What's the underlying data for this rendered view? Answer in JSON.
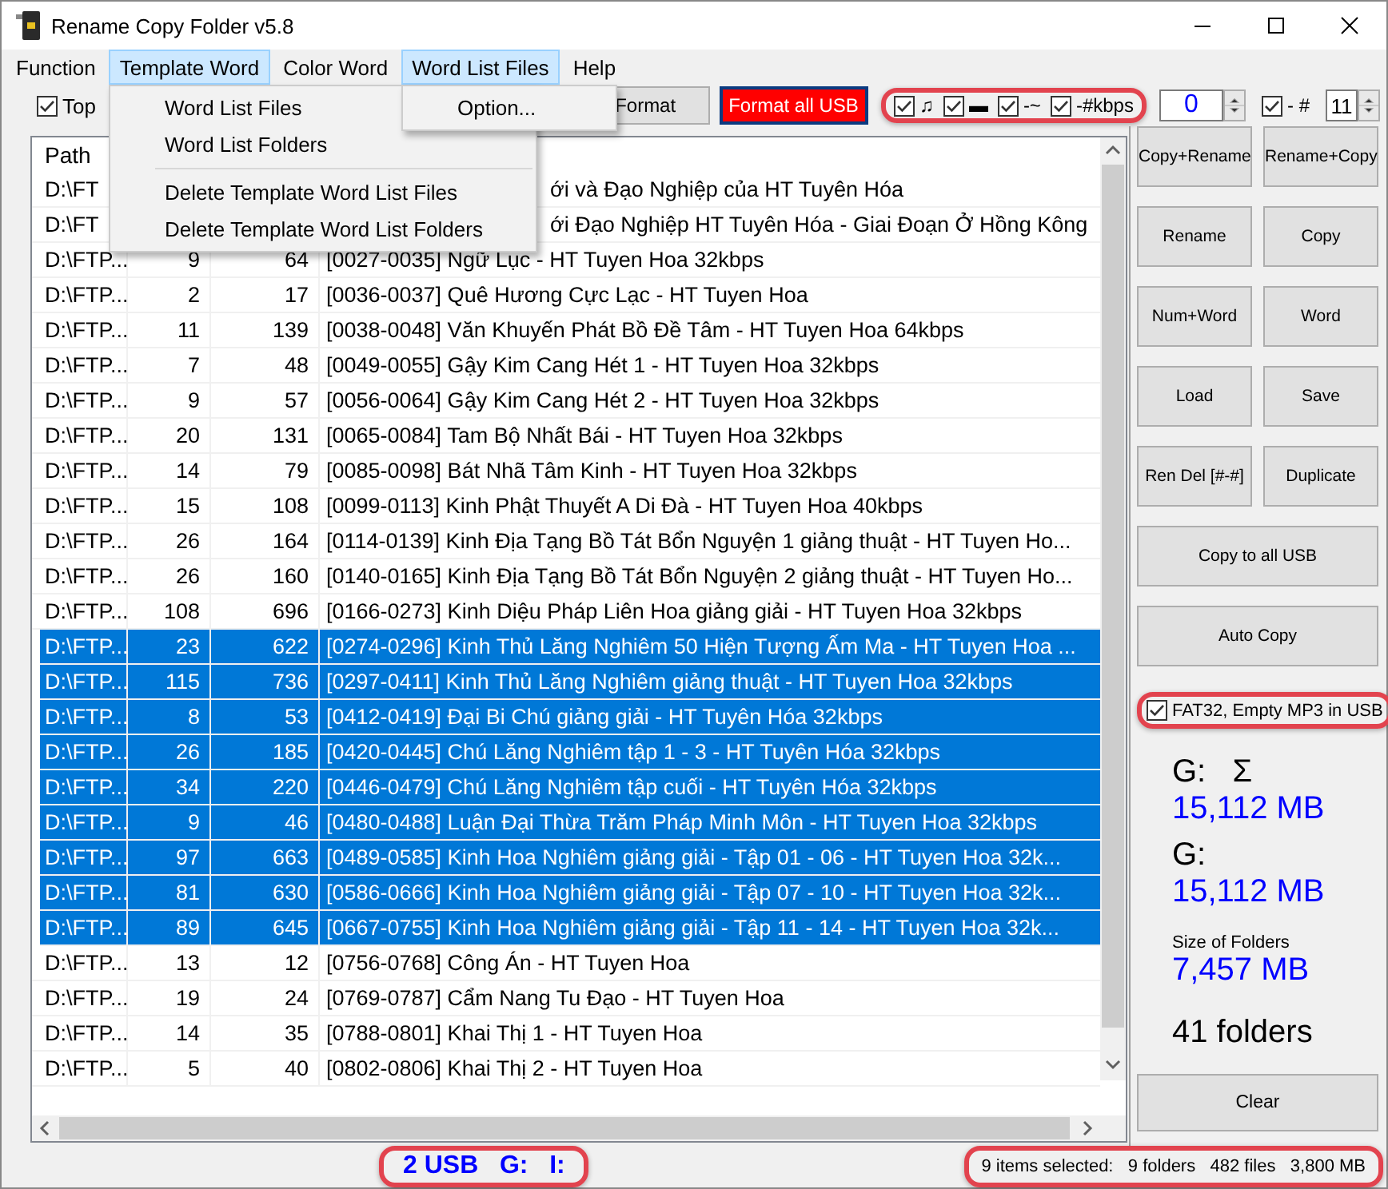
{
  "window": {
    "title": "Rename Copy Folder v5.8"
  },
  "menu_bar": [
    {
      "label": "Function",
      "open": false
    },
    {
      "label": "Template Word",
      "open": true,
      "items": [
        {
          "kind": "item",
          "label": "Word List Files"
        },
        {
          "kind": "item",
          "label": "Word List Folders"
        },
        {
          "kind": "separator"
        },
        {
          "kind": "item",
          "label": "Delete Template Word List Files"
        },
        {
          "kind": "item",
          "label": "Delete Template Word List Folders"
        }
      ]
    },
    {
      "label": "Color Word",
      "open": false
    },
    {
      "label": "Word List Files",
      "open": true,
      "items": [
        {
          "kind": "item",
          "label": "Option..."
        }
      ]
    },
    {
      "label": "Help",
      "open": false
    }
  ],
  "toolbar": {
    "top_checkbox": {
      "label": "Top",
      "checked": true
    },
    "buttons": [
      {
        "label": "Format",
        "kind": "normal"
      },
      {
        "label": "Format all USB",
        "kind": "danger"
      }
    ],
    "option_checks": {
      "highlighted": true,
      "items": [
        {
          "label": "♫",
          "checked": true
        },
        {
          "label": "▬",
          "checked": true
        },
        {
          "label": "-~",
          "checked": true
        },
        {
          "label": "-#kbps",
          "checked": true
        }
      ]
    },
    "start_number": {
      "value": "0"
    },
    "number_check": {
      "label": "- #",
      "checked": true
    },
    "digits": {
      "value": "11"
    }
  },
  "table": {
    "columns": [
      {
        "label": "Path"
      }
    ],
    "rows": [
      {
        "path": "D:\\FT",
        "column_4": "ới và Đạo Nghiệp của HT Tuyên Hóa",
        "covered": true,
        "selected": false
      },
      {
        "path": "D:\\FT",
        "column_4": "ới Đạo Nghiệp HT Tuyên Hóa - Giai Đoạn Ở Hồng Kông",
        "covered": true,
        "selected": false
      },
      {
        "path": "D:\\FTP...",
        "column_2": "9",
        "column_3": "64",
        "column_4": "[0027-0035] Ngữ Lục - HT Tuyen Hoa 32kbps",
        "covered": false,
        "selected": false
      },
      {
        "path": "D:\\FTP...",
        "column_2": "2",
        "column_3": "17",
        "column_4": "[0036-0037] Quê Hương Cực Lạc - HT Tuyen Hoa",
        "covered": false,
        "selected": false
      },
      {
        "path": "D:\\FTP...",
        "column_2": "11",
        "column_3": "139",
        "column_4": "[0038-0048] Văn Khuyến Phát Bồ Đề Tâm - HT Tuyen Hoa 64kbps",
        "covered": false,
        "selected": false
      },
      {
        "path": "D:\\FTP...",
        "column_2": "7",
        "column_3": "48",
        "column_4": "[0049-0055] Gậy Kim Cang Hét 1 - HT Tuyen Hoa 32kbps",
        "covered": false,
        "selected": false
      },
      {
        "path": "D:\\FTP...",
        "column_2": "9",
        "column_3": "57",
        "column_4": "[0056-0064] Gậy Kim Cang Hét 2 - HT Tuyen Hoa 32kbps",
        "covered": false,
        "selected": false
      },
      {
        "path": "D:\\FTP...",
        "column_2": "20",
        "column_3": "131",
        "column_4": "[0065-0084] Tam Bộ Nhất Bái - HT Tuyen Hoa 32kbps",
        "covered": false,
        "selected": false
      },
      {
        "path": "D:\\FTP...",
        "column_2": "14",
        "column_3": "79",
        "column_4": "[0085-0098] Bát Nhã Tâm Kinh - HT Tuyen Hoa 32kbps",
        "covered": false,
        "selected": false
      },
      {
        "path": "D:\\FTP...",
        "column_2": "15",
        "column_3": "108",
        "column_4": "[0099-0113] Kinh Phật Thuyết A Di Đà - HT Tuyen Hoa 40kbps",
        "covered": false,
        "selected": false
      },
      {
        "path": "D:\\FTP...",
        "column_2": "26",
        "column_3": "164",
        "column_4": "[0114-0139] Kinh Địa Tạng Bồ Tát Bổn Nguyện 1 giảng thuật - HT Tuyen Ho...",
        "covered": false,
        "selected": false
      },
      {
        "path": "D:\\FTP...",
        "column_2": "26",
        "column_3": "160",
        "column_4": "[0140-0165] Kinh Địa Tạng Bồ Tát Bổn Nguyện 2 giảng thuật - HT Tuyen Ho...",
        "covered": false,
        "selected": false
      },
      {
        "path": "D:\\FTP...",
        "column_2": "108",
        "column_3": "696",
        "column_4": "[0166-0273] Kinh Diệu Pháp Liên Hoa giảng giải - HT Tuyen Hoa 32kbps",
        "covered": false,
        "selected": false
      },
      {
        "path": "D:\\FTP...",
        "column_2": "23",
        "column_3": "622",
        "column_4": "[0274-0296] Kinh Thủ Lăng Nghiêm 50 Hiện Tượng Ấm Ma - HT Tuyen Hoa ...",
        "covered": false,
        "selected": true
      },
      {
        "path": "D:\\FTP...",
        "column_2": "115",
        "column_3": "736",
        "column_4": "[0297-0411] Kinh Thủ Lăng Nghiêm giảng thuật - HT Tuyen Hoa 32kbps",
        "covered": false,
        "selected": true
      },
      {
        "path": "D:\\FTP...",
        "column_2": "8",
        "column_3": "53",
        "column_4": "[0412-0419] Đại Bi Chú giảng giải - HT Tuyên Hóa 32kbps",
        "covered": false,
        "selected": true
      },
      {
        "path": "D:\\FTP...",
        "column_2": "26",
        "column_3": "185",
        "column_4": "[0420-0445] Chú Lăng Nghiêm tập 1 - 3 - HT Tuyên Hóa 32kbps",
        "covered": false,
        "selected": true
      },
      {
        "path": "D:\\FTP...",
        "column_2": "34",
        "column_3": "220",
        "column_4": "[0446-0479] Chú Lăng Nghiêm tập cuối - HT Tuyên Hóa 32kbps",
        "covered": false,
        "selected": true
      },
      {
        "path": "D:\\FTP...",
        "column_2": "9",
        "column_3": "46",
        "column_4": "[0480-0488] Luận Đại Thừa Trăm Pháp Minh Môn - HT Tuyen Hoa 32kbps",
        "covered": false,
        "selected": true
      },
      {
        "path": "D:\\FTP...",
        "column_2": "97",
        "column_3": "663",
        "column_4": "[0489-0585] Kinh Hoa Nghiêm giảng giải - Tập 01 - 06 - HT Tuyen Hoa 32k...",
        "covered": false,
        "selected": true
      },
      {
        "path": "D:\\FTP...",
        "column_2": "81",
        "column_3": "630",
        "column_4": "[0586-0666] Kinh Hoa Nghiêm giảng giải - Tập 07 - 10 - HT Tuyen Hoa 32k...",
        "covered": false,
        "selected": true
      },
      {
        "path": "D:\\FTP...",
        "column_2": "89",
        "column_3": "645",
        "column_4": "[0667-0755] Kinh Hoa Nghiêm giảng giải - Tập 11 - 14 - HT Tuyen Hoa 32k...",
        "covered": false,
        "selected": true
      },
      {
        "path": "D:\\FTP...",
        "column_2": "13",
        "column_3": "12",
        "column_4": "[0756-0768] Công Án - HT Tuyen Hoa",
        "covered": false,
        "selected": false
      },
      {
        "path": "D:\\FTP...",
        "column_2": "19",
        "column_3": "24",
        "column_4": "[0769-0787] Cẩm Nang Tu Đạo - HT Tuyen Hoa",
        "covered": false,
        "selected": false
      },
      {
        "path": "D:\\FTP...",
        "column_2": "14",
        "column_3": "35",
        "column_4": "[0788-0801] Khai Thị 1 - HT Tuyen Hoa",
        "covered": false,
        "selected": false
      },
      {
        "path": "D:\\FTP...",
        "column_2": "5",
        "column_3": "40",
        "column_4": "[0802-0806] Khai Thị 2 - HT Tuyen Hoa",
        "covered": false,
        "selected": false
      }
    ]
  },
  "side_panel": {
    "buttons": [
      {
        "label": "Copy+Rename",
        "kind": "half"
      },
      {
        "label": "Rename+Copy",
        "kind": "half"
      },
      {
        "label": "Rename",
        "kind": "half"
      },
      {
        "label": "Copy",
        "kind": "half"
      },
      {
        "label": "Num+Word",
        "kind": "half"
      },
      {
        "label": "Word",
        "kind": "half"
      },
      {
        "label": "Load",
        "kind": "half"
      },
      {
        "label": "Save",
        "kind": "half"
      },
      {
        "label": "Ren Del [#-#]",
        "kind": "half"
      },
      {
        "label": "Duplicate",
        "kind": "half"
      },
      {
        "label": "Copy to all USB",
        "kind": "wide"
      },
      {
        "label": "Auto Copy",
        "kind": "wide"
      }
    ],
    "fat32_checkbox": {
      "label": "FAT32, Empty MP3 in USB",
      "checked": true,
      "highlighted": true
    },
    "stats": [
      {
        "kind": "drive",
        "text": "G:   Σ"
      },
      {
        "kind": "size",
        "text": "15,112 MB"
      },
      {
        "kind": "drive",
        "text": "G:"
      },
      {
        "kind": "size",
        "text": "15,112 MB"
      },
      {
        "kind": "caption",
        "text": "Size of Folders"
      },
      {
        "kind": "size",
        "text": "7,457 MB"
      },
      {
        "kind": "count",
        "text": "41 folders"
      }
    ],
    "clear_button": {
      "label": "Clear"
    }
  },
  "status_bar": {
    "usb": {
      "text": "2 USB   G:   I:",
      "highlighted": true
    },
    "selection": {
      "text": "9 items selected:   9 folders   482 files   3,800 MB",
      "highlighted": true
    }
  }
}
